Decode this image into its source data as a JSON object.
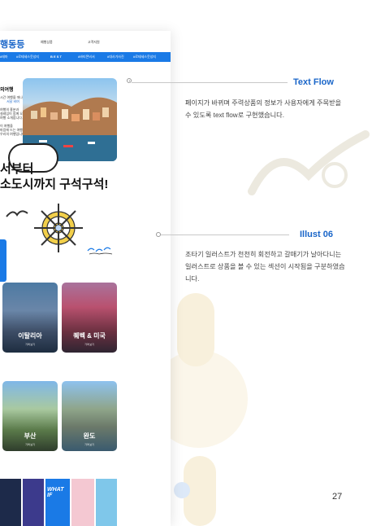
{
  "screenshot": {
    "brand": "행동등",
    "top_links": [
      "예행상품",
      "고객지원"
    ],
    "nav_items": [
      "#테마",
      "#로테세스웃성지",
      "B E S T",
      "#바티몬비서",
      "#대사가사진",
      "#로테세스웃성지"
    ],
    "side_title": "외여행",
    "side_lines": [
      "시간 여행을 떠나요",
      "서달 비여",
      "여행의 흥분과",
      "설레임이 함께 오는",
      "여행 소개합니다.",
      "이 여행을",
      "마음에 드는 여행과",
      "우리의 여행입니다."
    ],
    "hero_line1": "서부터",
    "hero_line2": "소도시까지 구석구석!",
    "cards": [
      {
        "title": "이탈리아",
        "sub": "가격 보기"
      },
      {
        "title": "퀘벡 & 미국",
        "sub": "가격 보기"
      },
      {
        "title": "부산",
        "sub": "가격 보기"
      },
      {
        "title": "완도",
        "sub": "가격 보기"
      }
    ],
    "bottom_caption": "WHAT IF"
  },
  "annotations": [
    {
      "title": "Text Flow",
      "desc": "페이지가 바뀌며 주력상품의 정보가 사용자에게 주목받을 수 있도록 text flow로 구현했습니다."
    },
    {
      "title": "Illust 06",
      "desc": "조타기 일러스트가 천천히 회전하고 갈매기가 날아다니는 일러스트로 상품을 볼 수 있는 섹션이 시작됨을 구분하였습니다."
    }
  ],
  "page_number": "27",
  "colors": {
    "accent": "#1a66c9",
    "nav": "#1a7ae6",
    "wheel": "#f2cf4a"
  }
}
